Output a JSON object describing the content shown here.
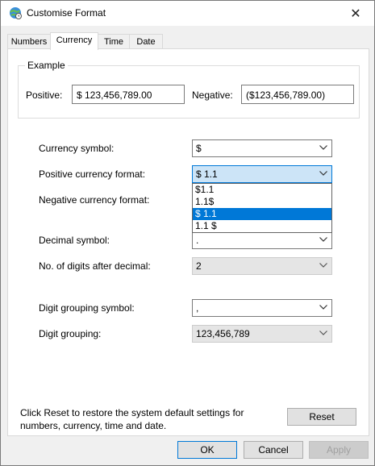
{
  "window": {
    "title": "Customise Format",
    "close_glyph": "✕"
  },
  "tabs": [
    {
      "label": "Numbers",
      "active": false
    },
    {
      "label": "Currency",
      "active": true
    },
    {
      "label": "Time",
      "active": false
    },
    {
      "label": "Date",
      "active": false
    }
  ],
  "example": {
    "legend": "Example",
    "positive_label": "Positive:",
    "positive_value": "$ 123,456,789.00",
    "negative_label": "Negative:",
    "negative_value": "($123,456,789.00)"
  },
  "fields": {
    "currency_symbol": {
      "label": "Currency symbol:",
      "value": "$"
    },
    "positive_format": {
      "label": "Positive currency format:",
      "value": "$ 1.1"
    },
    "negative_format": {
      "label": "Negative currency format:",
      "value": ""
    },
    "decimal_symbol": {
      "label": "Decimal symbol:",
      "value": "."
    },
    "digits_after_decimal": {
      "label": "No. of digits after decimal:",
      "value": "2"
    },
    "digit_grouping_symbol": {
      "label": "Digit grouping symbol:",
      "value": ","
    },
    "digit_grouping": {
      "label": "Digit grouping:",
      "value": "123,456,789"
    }
  },
  "positive_format_options": [
    "$1.1",
    "1.1$",
    "$ 1.1",
    "1.1 $"
  ],
  "positive_format_selected_index": 2,
  "reset": {
    "description": "Click Reset to restore the system default settings for numbers, currency, time and date.",
    "button_label": "Reset"
  },
  "footer": {
    "ok_label": "OK",
    "cancel_label": "Cancel",
    "apply_label": "Apply"
  },
  "icons": {
    "window_icon": "globe-clock-icon",
    "close_icon": "close-icon",
    "dropdown_icon": "chevron-down-icon"
  },
  "colors": {
    "accent": "#0078d7",
    "selection": "#0078d7",
    "focus_bg": "#cce4f7"
  }
}
